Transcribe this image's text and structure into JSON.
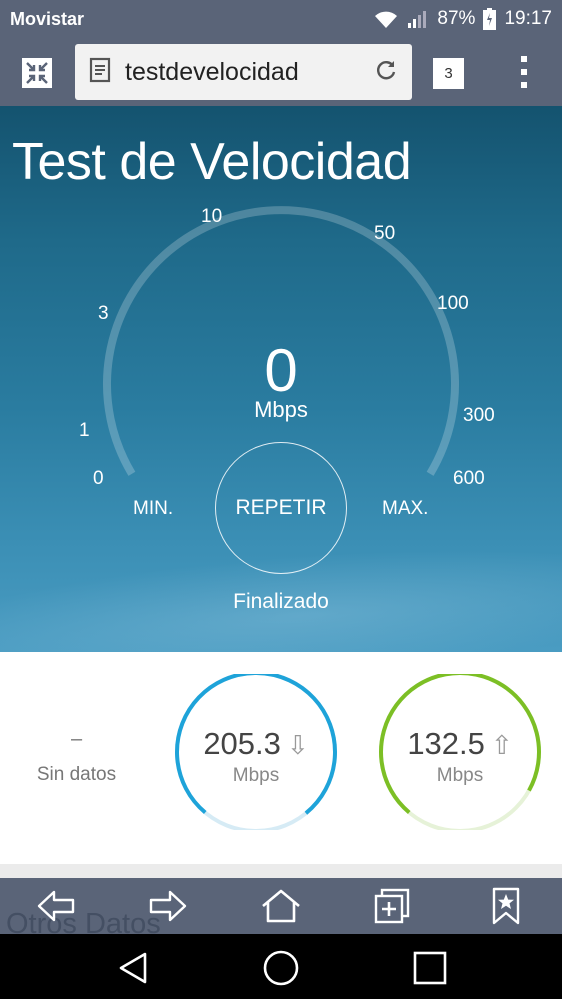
{
  "status_bar": {
    "carrier": "Movistar",
    "battery": "87%",
    "time": "19:17"
  },
  "browser": {
    "url": "testdevelocidad",
    "tab_count": "3",
    "icons": [
      "exit-fullscreen-icon",
      "page-icon",
      "reload-icon",
      "overflow-menu-icon"
    ]
  },
  "speedtest": {
    "title": "Test de Velocidad",
    "ticks": [
      "0",
      "1",
      "3",
      "10",
      "50",
      "100",
      "300",
      "600"
    ],
    "value": "0",
    "unit": "Mbps",
    "min_label": "MIN.",
    "max_label": "MAX.",
    "repeat_label": "REPETIR",
    "status": "Finalizado"
  },
  "results": {
    "ping": {
      "value": "–",
      "label": "Sin datos"
    },
    "download": {
      "value": "205.3",
      "unit": "Mbps",
      "arrow": "⇩",
      "color": "#1ea3d9",
      "fill_fraction": 0.78
    },
    "upload": {
      "value": "132.5",
      "unit": "Mbps",
      "arrow": "⇧",
      "color": "#7cbf25",
      "fill_fraction": 0.72
    }
  },
  "bottom": {
    "other_data": "Otros Datos",
    "nav_icons": [
      "back-arrow-icon",
      "forward-arrow-icon",
      "home-icon",
      "add-tab-icon",
      "bookmark-icon"
    ]
  },
  "colors": {
    "chrome": "#5a6478",
    "hero": "#2a7ca0"
  }
}
